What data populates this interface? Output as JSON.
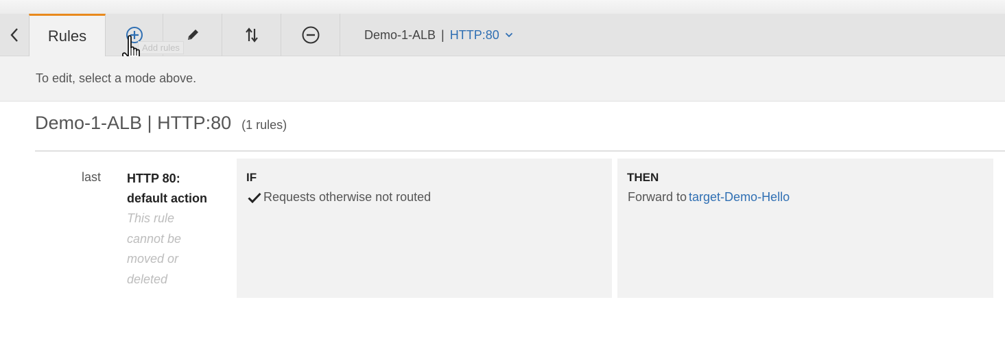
{
  "toolbar": {
    "active_tab": "Rules",
    "tooltip": "Add rules",
    "listener": {
      "name": "Demo-1-ALB",
      "separator": "|",
      "protocol": "HTTP:80"
    }
  },
  "hint": "To edit, select a mode above.",
  "section": {
    "title": "Demo-1-ALB | HTTP:80",
    "rule_count": "(1 rules)"
  },
  "rules": [
    {
      "priority": "last",
      "name_line1": "HTTP 80:",
      "name_line2": "default action",
      "note": "This rule cannot be moved or deleted",
      "if_label": "IF",
      "condition": "Requests otherwise not routed",
      "then_label": "THEN",
      "action_prefix": "Forward to",
      "target": "target-Demo-Hello"
    }
  ],
  "icons": {
    "back": "chevron-left-icon",
    "add": "plus-circle-icon",
    "edit": "pencil-icon",
    "reorder": "reorder-arrows-icon",
    "delete": "minus-circle-icon",
    "dropdown": "chevron-down-icon",
    "check": "check-icon",
    "cursor": "hand-pointer-icon"
  },
  "colors": {
    "accent": "#e8891c",
    "link": "#2f6fb3",
    "toolbar_bg": "#e4e4e4",
    "panel_bg": "#f2f2f2"
  }
}
